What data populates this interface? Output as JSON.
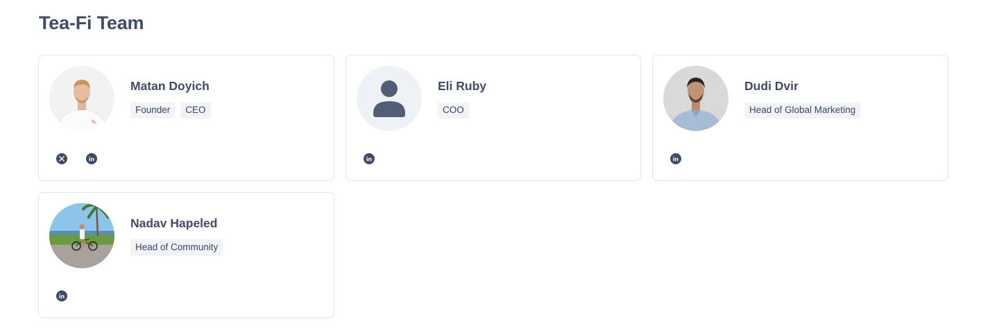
{
  "section": {
    "title": "Tea-Fi Team"
  },
  "members": [
    {
      "name": "Matan Doyich",
      "roles": [
        "Founder",
        "CEO"
      ],
      "socials": [
        "x-twitter-icon",
        "linkedin-icon"
      ]
    },
    {
      "name": "Eli Ruby",
      "roles": [
        "COO"
      ],
      "socials": [
        "linkedin-icon"
      ]
    },
    {
      "name": "Dudi Dvir",
      "roles": [
        "Head of Global Marketing"
      ],
      "socials": [
        "linkedin-icon"
      ]
    },
    {
      "name": "Nadav Hapeled",
      "roles": [
        "Head of Community"
      ],
      "socials": [
        "linkedin-icon"
      ]
    }
  ],
  "colors": {
    "text": "#414b62",
    "badge_bg": "#f1f3f8",
    "border": "#e1e3e8",
    "icon_bg": "#3f4a63",
    "placeholder_bg": "#eef1f5",
    "placeholder_icon": "#525e78"
  }
}
